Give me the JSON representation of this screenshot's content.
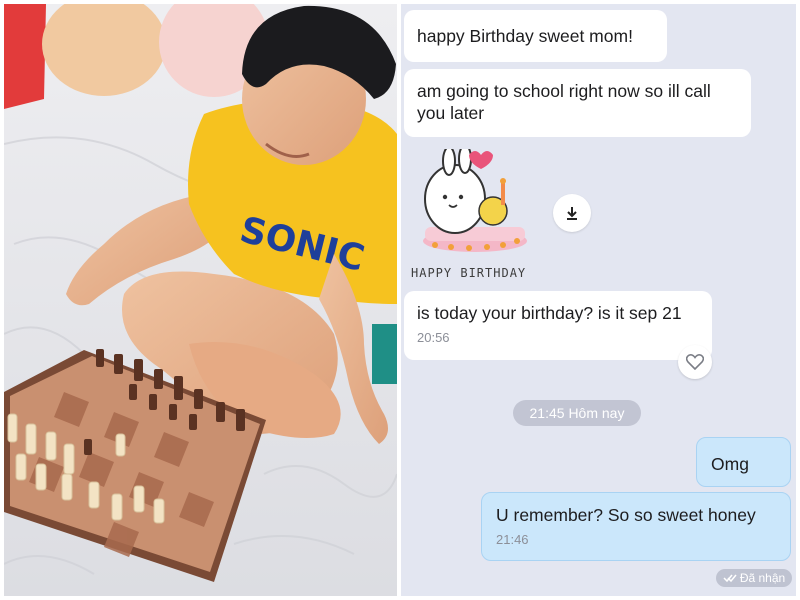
{
  "chat": {
    "messages": [
      {
        "text": "happy Birthday sweet mom!",
        "time": ""
      },
      {
        "text": "am going to school right now so ill call you later",
        "time": ""
      },
      {
        "text": "is today your birthday? is it sep 21",
        "time": "20:56"
      },
      {
        "text": "Omg",
        "time": ""
      },
      {
        "text": "U remember? So so sweet honey",
        "time": "21:46"
      }
    ],
    "sticker_caption": "HAPPY BIRTHDAY",
    "date_separator": "21:45 Hôm nay",
    "seen_status": "Đã nhận"
  },
  "photo": {
    "shirt_text": "SONIC",
    "icons": {
      "download": "download-icon",
      "react": "heart-icon",
      "seen": "double-check-icon"
    }
  },
  "colors": {
    "chat_bg": "#e3e6f1",
    "incoming_bubble": "#ffffff",
    "outgoing_bubble": "#cbe7fb",
    "pill": "#c2c5d3",
    "shirt": "#f6c21f"
  }
}
